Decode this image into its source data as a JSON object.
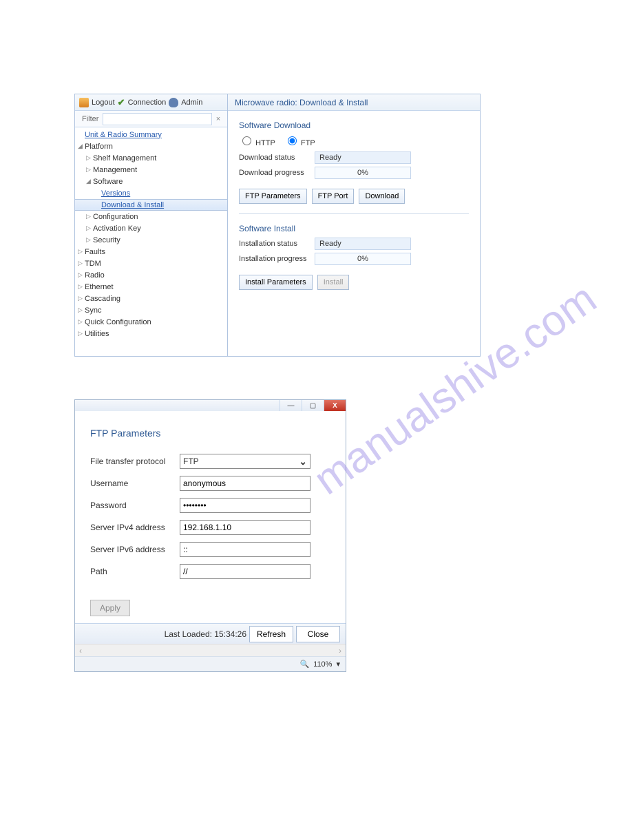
{
  "watermark": "manualshive.com",
  "toolbar": {
    "logout": "Logout",
    "connection": "Connection",
    "admin": "Admin"
  },
  "filter": {
    "label": "Filter",
    "value": "",
    "clear": "×"
  },
  "tree": {
    "unit_radio": "Unit & Radio Summary",
    "platform": "Platform",
    "shelf_mgmt": "Shelf Management",
    "management": "Management",
    "software": "Software",
    "versions": "Versions",
    "download_install": "Download & Install",
    "configuration": "Configuration",
    "activation_key": "Activation Key",
    "security": "Security",
    "faults": "Faults",
    "tdm": "TDM",
    "radio": "Radio",
    "ethernet": "Ethernet",
    "cascading": "Cascading",
    "sync": "Sync",
    "quick_config": "Quick Configuration",
    "utilities": "Utilities"
  },
  "content": {
    "title": "Microwave radio: Download & Install",
    "software_download": "Software Download",
    "http": "HTTP",
    "ftp": "FTP",
    "download_status_label": "Download status",
    "download_status_value": "Ready",
    "download_progress_label": "Download progress",
    "download_progress_value": "0%",
    "ftp_parameters_btn": "FTP Parameters",
    "ftp_port_btn": "FTP Port",
    "download_btn": "Download",
    "software_install": "Software Install",
    "install_status_label": "Installation status",
    "install_status_value": "Ready",
    "install_progress_label": "Installation progress",
    "install_progress_value": "0%",
    "install_parameters_btn": "Install Parameters",
    "install_btn": "Install"
  },
  "ftp_dialog": {
    "title": "FTP Parameters",
    "protocol_label": "File transfer protocol",
    "protocol_value": "FTP",
    "username_label": "Username",
    "username_value": "anonymous",
    "password_label": "Password",
    "password_value": "••••••••",
    "ipv4_label": "Server IPv4 address",
    "ipv4_value": "192.168.1.10",
    "ipv6_label": "Server IPv6 address",
    "ipv6_value": "::",
    "path_label": "Path",
    "path_value": "//",
    "apply": "Apply",
    "last_loaded": "Last Loaded: 15:34:26",
    "refresh": "Refresh",
    "close": "Close",
    "zoom": "110%"
  },
  "winbtns": {
    "min": "—",
    "max": "▢",
    "close": "X"
  }
}
